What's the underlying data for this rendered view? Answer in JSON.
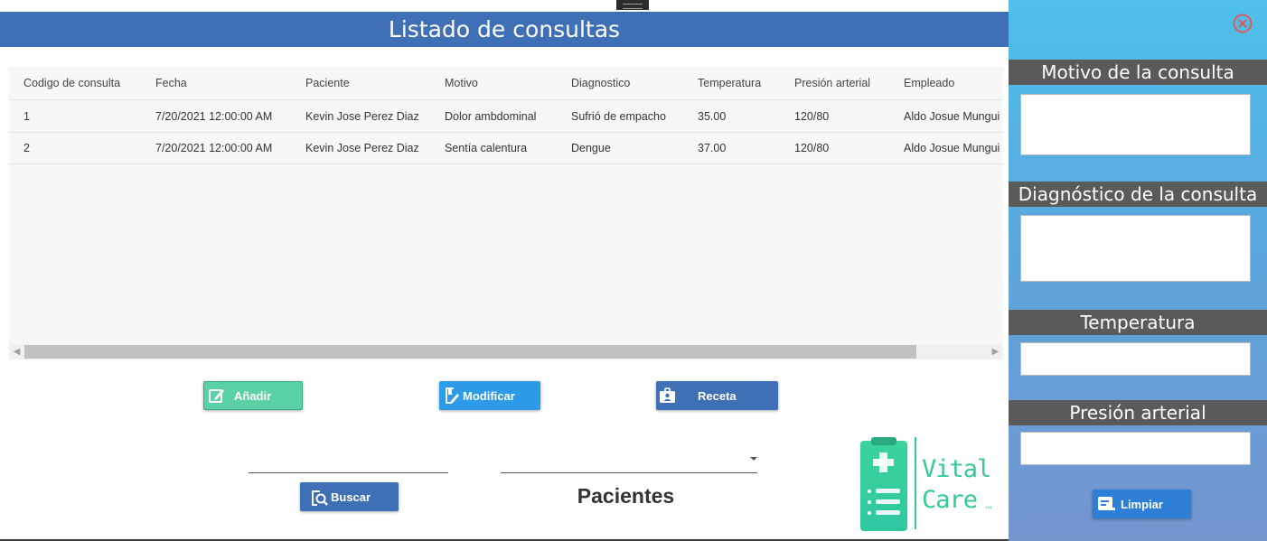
{
  "header": {
    "title": "Listado de consultas"
  },
  "table": {
    "columns": [
      "Codigo de consulta",
      "Fecha",
      "Paciente",
      "Motivo",
      "Diagnostico",
      "Temperatura",
      "Presión arterial",
      "Empleado"
    ],
    "rows": [
      [
        "1",
        "7/20/2021 12:00:00 AM",
        "Kevin Jose Perez Diaz",
        "Dolor ambdominal",
        "Sufrió de empacho",
        "35.00",
        "120/80",
        "Aldo Josue Mungui"
      ],
      [
        "2",
        "7/20/2021 12:00:00 AM",
        "Kevin Jose Perez Diaz",
        "Sentía calentura",
        "Dengue",
        "37.00",
        "120/80",
        "Aldo Josue Mungui"
      ]
    ],
    "scroll_left_arrow": "◀",
    "scroll_right_arrow": "▶"
  },
  "actions": {
    "add_label": "Añadir",
    "modify_label": "Modificar",
    "prescription_label": "Receta",
    "search_label": "Buscar"
  },
  "search": {
    "value": ""
  },
  "patients": {
    "selected": "",
    "label": "Pacientes"
  },
  "logo": {
    "line1": "Vital",
    "line2": "Care",
    "mark": "™"
  },
  "panel": {
    "motivo_label": "Motivo de la consulta",
    "motivo_value": "",
    "diagnostico_label": "Diagnóstico de la consulta",
    "diagnostico_value": "",
    "temperatura_label": "Temperatura",
    "temperatura_value": "",
    "presion_label": "Presión arterial",
    "presion_value": "",
    "clear_label": "Limpiar"
  },
  "colors": {
    "header": "#3f6fb5",
    "add_button": "#5ad1a5",
    "modify_button": "#2d9be8",
    "prescription_button": "#3f6fb5",
    "panel_top": "#4ec0ea",
    "panel_bottom": "#7595cf",
    "close_icon": "#e05a5a",
    "logo": "#35c999"
  },
  "icons": {
    "close": "close-circle-icon",
    "add": "edit-square-icon",
    "modify": "edit-document-icon",
    "prescription": "badge-icon",
    "search": "search-document-icon",
    "clear": "clear-form-icon",
    "dropdown": "chevron-down-icon"
  }
}
